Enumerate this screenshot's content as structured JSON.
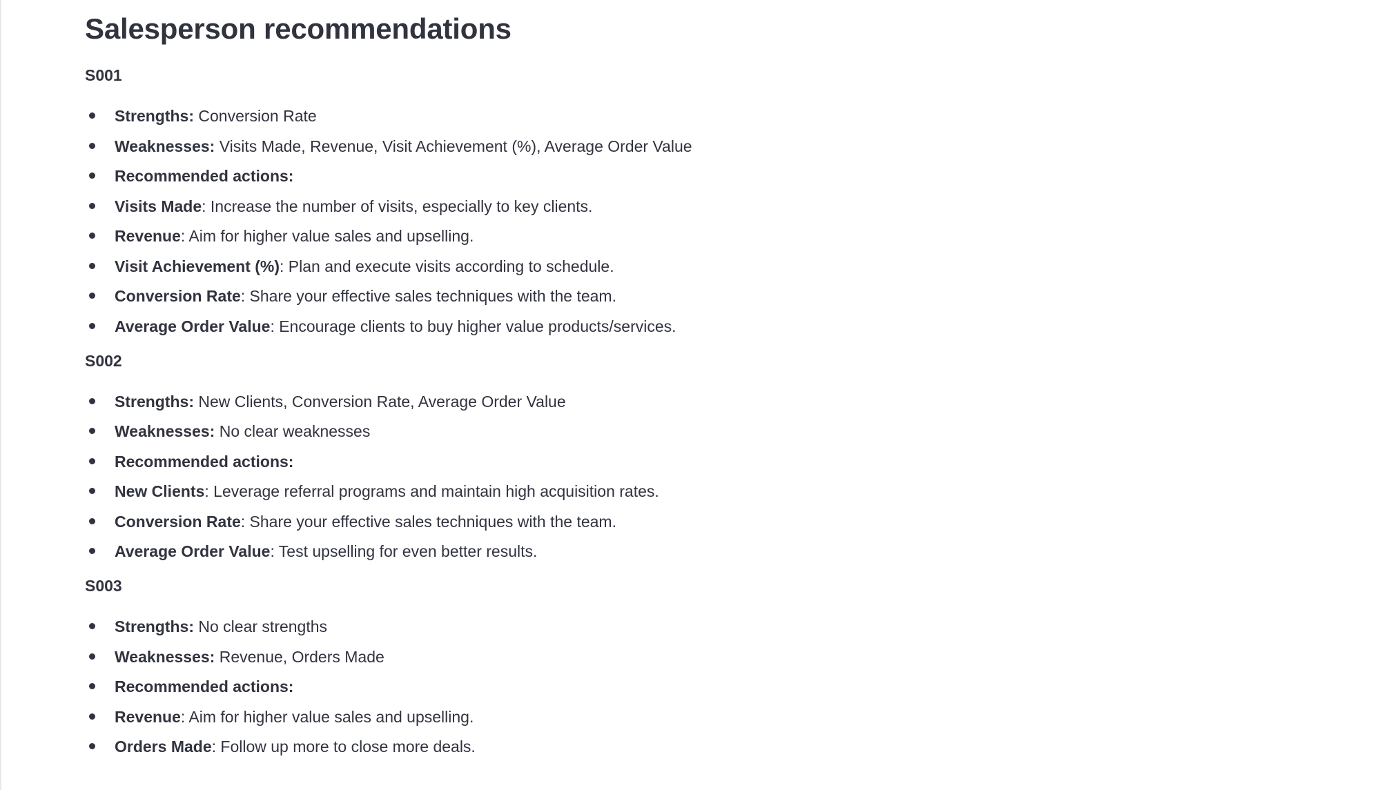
{
  "page": {
    "title": "Salesperson recommendations"
  },
  "sections": [
    {
      "id": "S001",
      "items": [
        {
          "label": "Strengths:",
          "text": " Conversion Rate"
        },
        {
          "label": "Weaknesses:",
          "text": " Visits Made, Revenue, Visit Achievement (%), Average Order Value"
        },
        {
          "label": "Recommended actions:",
          "text": ""
        },
        {
          "label": "Visits Made",
          "text": ": Increase the number of visits, especially to key clients."
        },
        {
          "label": "Revenue",
          "text": ": Aim for higher value sales and upselling."
        },
        {
          "label": "Visit Achievement (%)",
          "text": ": Plan and execute visits according to schedule."
        },
        {
          "label": "Conversion Rate",
          "text": ": Share your effective sales techniques with the team."
        },
        {
          "label": "Average Order Value",
          "text": ": Encourage clients to buy higher value products/services."
        }
      ]
    },
    {
      "id": "S002",
      "items": [
        {
          "label": "Strengths:",
          "text": " New Clients, Conversion Rate, Average Order Value"
        },
        {
          "label": "Weaknesses:",
          "text": " No clear weaknesses"
        },
        {
          "label": "Recommended actions:",
          "text": ""
        },
        {
          "label": "New Clients",
          "text": ": Leverage referral programs and maintain high acquisition rates."
        },
        {
          "label": "Conversion Rate",
          "text": ": Share your effective sales techniques with the team."
        },
        {
          "label": "Average Order Value",
          "text": ": Test upselling for even better results."
        }
      ]
    },
    {
      "id": "S003",
      "items": [
        {
          "label": "Strengths:",
          "text": " No clear strengths"
        },
        {
          "label": "Weaknesses:",
          "text": " Revenue, Orders Made"
        },
        {
          "label": "Recommended actions:",
          "text": ""
        },
        {
          "label": "Revenue",
          "text": ": Aim for higher value sales and upselling."
        },
        {
          "label": "Orders Made",
          "text": ": Follow up more to close more deals."
        }
      ]
    }
  ]
}
